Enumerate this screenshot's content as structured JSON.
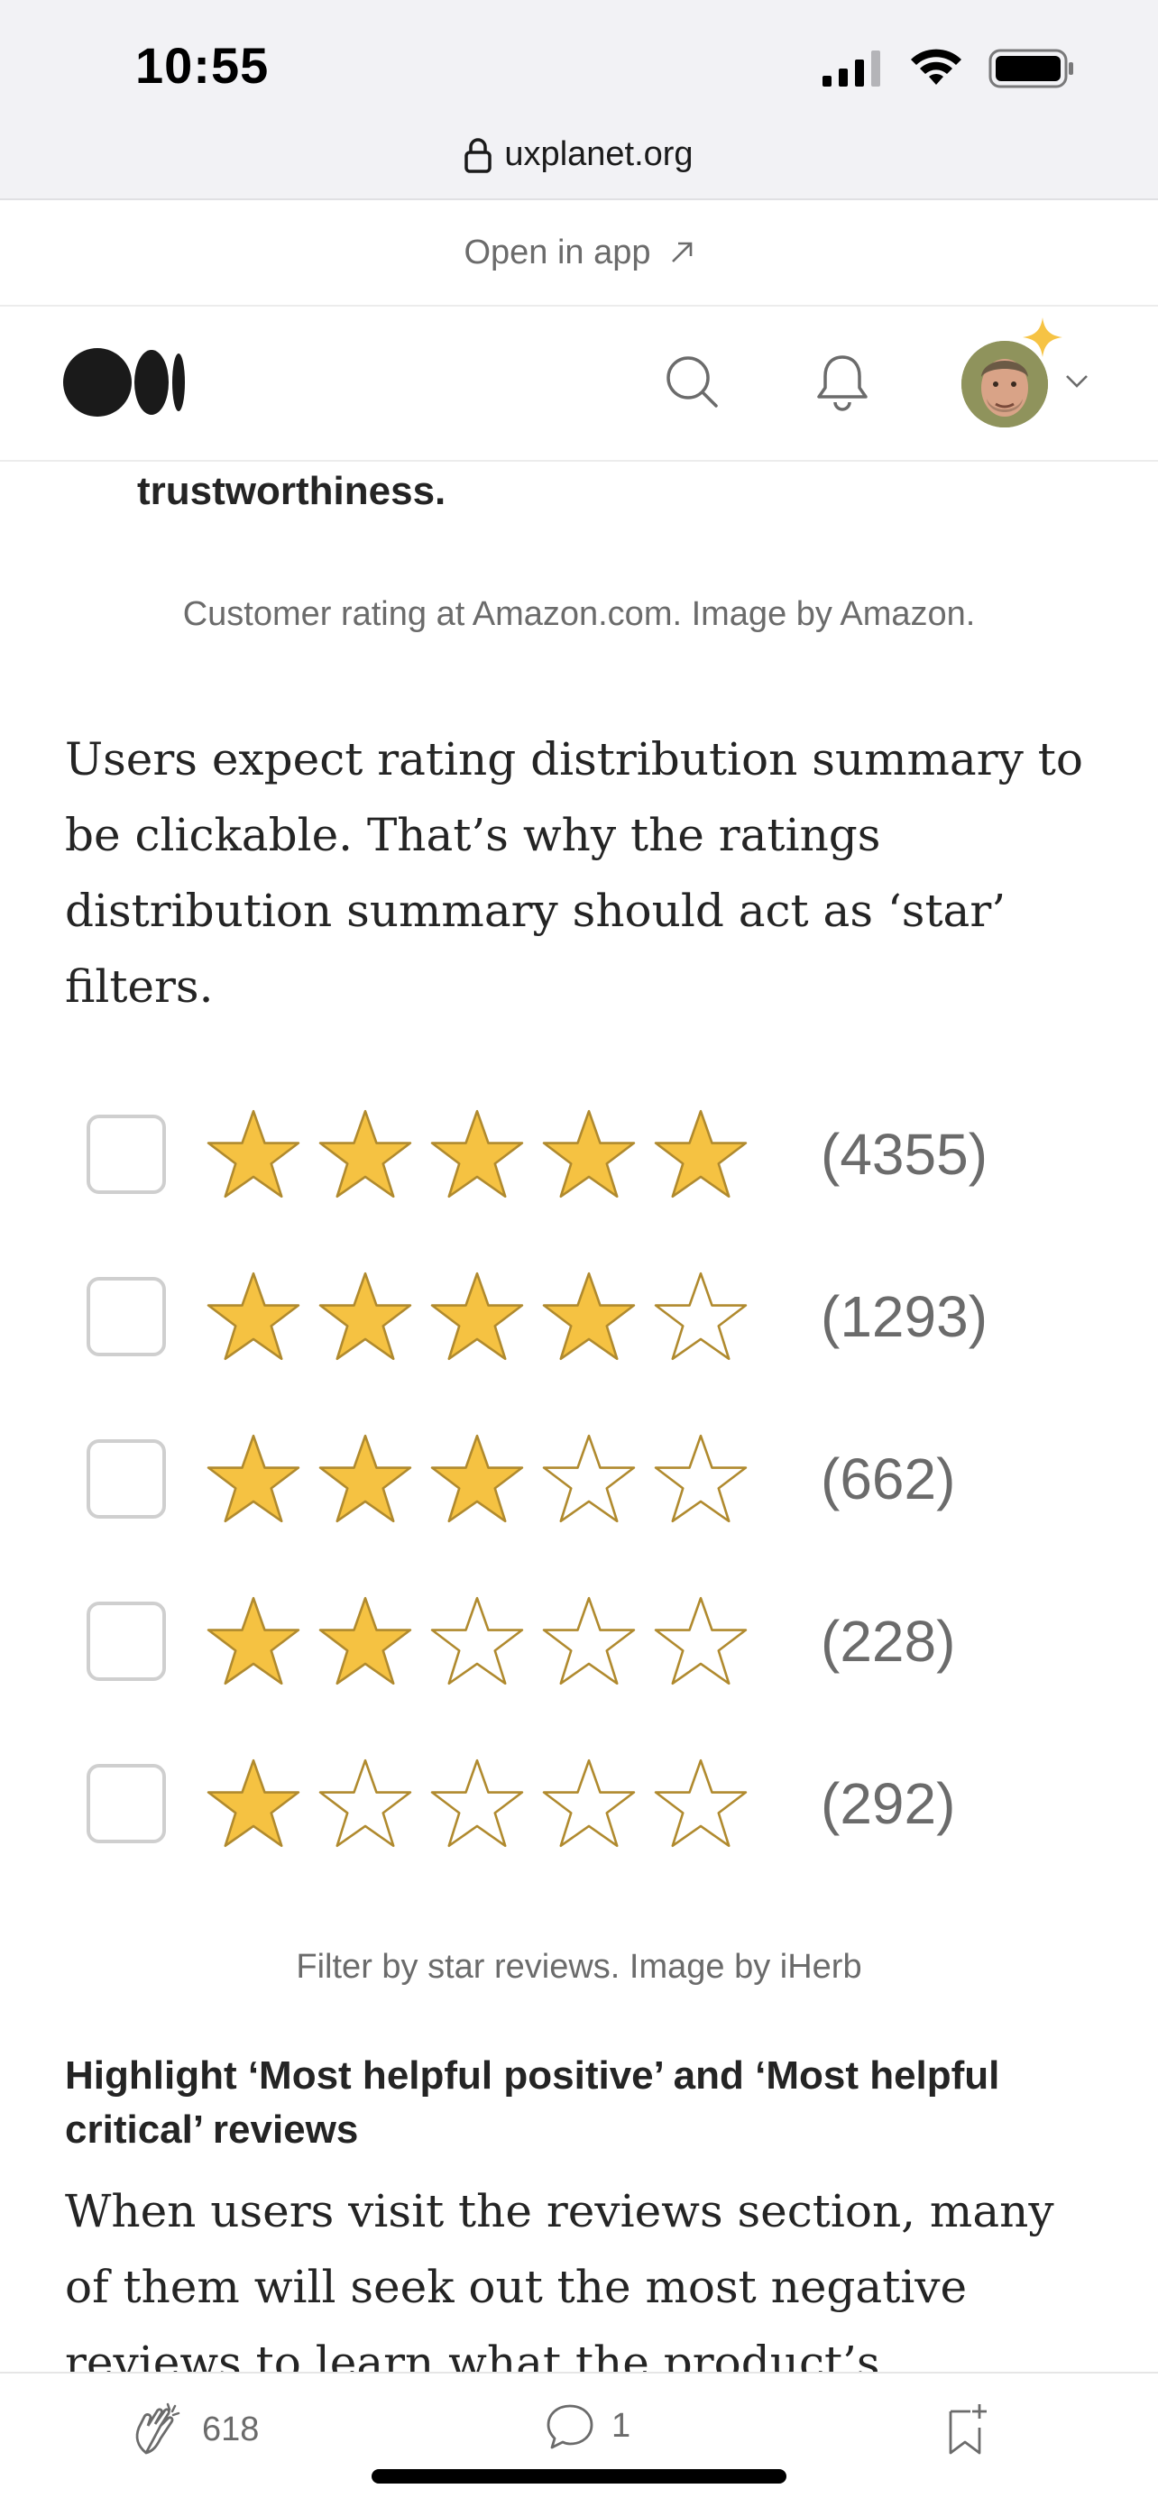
{
  "status_bar": {
    "time": "10:55"
  },
  "browser": {
    "url": "uxplanet.org"
  },
  "open_in_app": {
    "label": "Open in app"
  },
  "article": {
    "lead_fragment": "trustworthiness.",
    "caption_1": "Customer rating at Amazon.com. Image by Amazon.",
    "paragraph_1": "Users expect rating distribution summary to be clickable. That’s why the ratings distribution summary should act as ‘star’ filters.",
    "rating_filters": [
      {
        "stars": 5,
        "count": "(4355)"
      },
      {
        "stars": 4,
        "count": "(1293)"
      },
      {
        "stars": 3,
        "count": "(662)"
      },
      {
        "stars": 2,
        "count": "(228)"
      },
      {
        "stars": 1,
        "count": "(292)"
      }
    ],
    "caption_2": "Filter by star reviews. Image by iHerb",
    "subheading": "Highlight ‘Most helpful positive’ and ‘Most helpful critical’ reviews",
    "paragraph_2": "When users visit the reviews section, many of them will seek out the most negative reviews to learn what the product’s shortcomings are."
  },
  "bottom_bar": {
    "claps": "618",
    "comments": "1"
  },
  "colors": {
    "star_fill": "#F5C242",
    "star_stroke": "#B08A2E",
    "text": "#242424",
    "muted": "#6B6B6B"
  }
}
